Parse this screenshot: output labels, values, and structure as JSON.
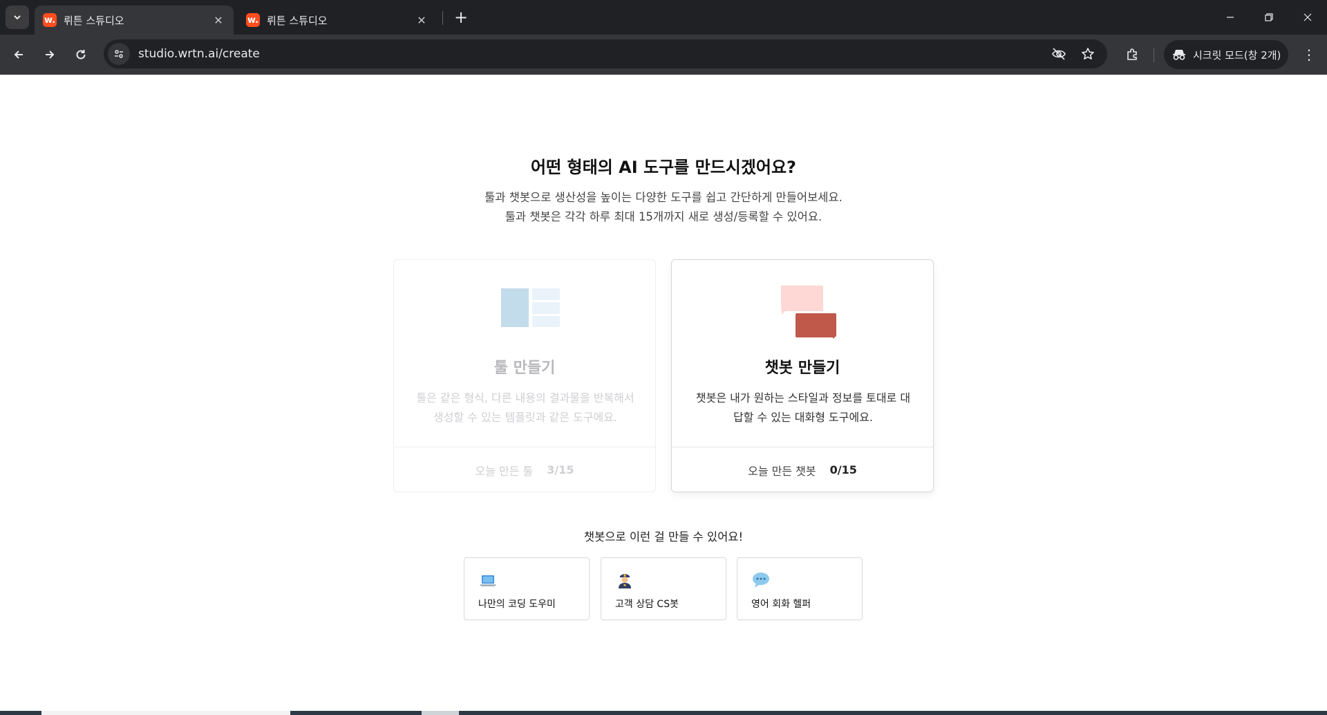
{
  "browser": {
    "tabs": [
      {
        "title": "뤼튼 스튜디오",
        "active": true
      },
      {
        "title": "뤼튼 스튜디오",
        "active": false
      }
    ],
    "favicon_text": "w.",
    "url": "studio.wrtn.ai/create",
    "incognito_label": "시크릿 모드(창 2개)",
    "icons": {
      "tab_search": "chevron-down-icon",
      "close": "close-icon",
      "new_tab": "plus-icon",
      "back": "arrow-left-icon",
      "forward": "arrow-right-icon",
      "reload": "reload-icon",
      "site_info": "tune-icon",
      "eye_off": "eye-off-icon",
      "bookmark": "star-icon",
      "extensions": "puzzle-icon",
      "incognito": "incognito-icon",
      "menu": "kebab-menu-icon",
      "minimize": "minimize-icon",
      "restore": "restore-icon",
      "window_close": "window-close-icon"
    }
  },
  "page": {
    "heading": "어떤 형태의 AI 도구를 만드시겠어요?",
    "subtext_line1": "툴과 챗봇으로 생산성을 높이는 다양한 도구를 쉽고 간단하게 만들어보세요.",
    "subtext_line2": "툴과 챗봇은 각각 하루 최대 15개까지 새로 생성/등록할 수 있어요.",
    "cards": {
      "tool": {
        "title": "툴 만들기",
        "desc": "툴은 같은 형식, 다른 내용의 결과물을 반복해서 생성할 수 있는 템플릿과 같은 도구에요.",
        "footer_label": "오늘 만든 툴",
        "footer_count": "3/15",
        "disabled": true
      },
      "chatbot": {
        "title": "챗봇 만들기",
        "desc": "챗봇은 내가 원하는 스타일과 정보를 토대로 대답할 수 있는 대화형 도구에요.",
        "footer_label": "오늘 만든 챗봇",
        "footer_count": "0/15",
        "disabled": false
      }
    },
    "examples_title": "챗봇으로 이런 걸 만들 수 있어요!",
    "examples": [
      {
        "label": "나만의 코딩 도우미",
        "icon": "laptop-icon"
      },
      {
        "label": "고객 상담 CS봇",
        "icon": "police-officer-icon"
      },
      {
        "label": "영어 회화 헬퍼",
        "icon": "speech-balloon-icon"
      }
    ],
    "colors": {
      "chat_bubble_light": "#fdd8d4",
      "chat_bubble_dark": "#c0594a",
      "tool_block_dark": "#c3dcec",
      "tool_block_light": "#eaf3fa"
    }
  }
}
